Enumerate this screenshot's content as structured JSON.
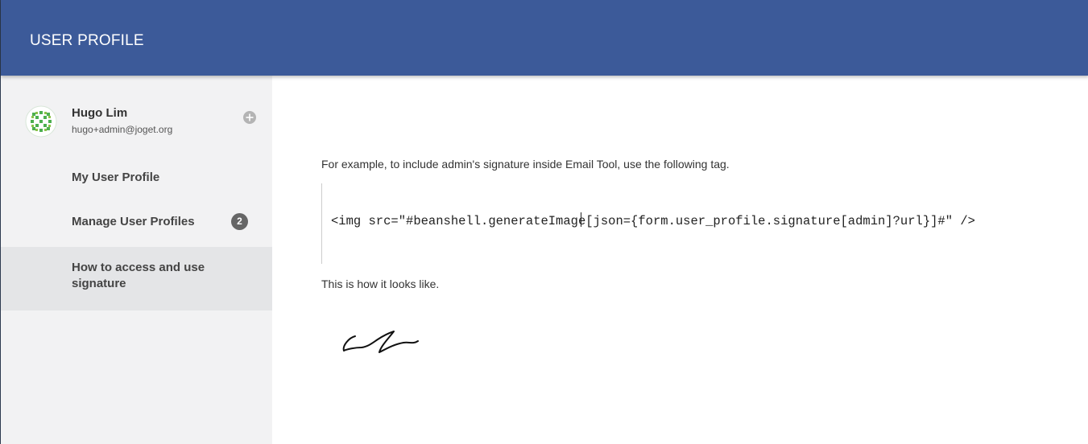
{
  "header": {
    "title": "USER PROFILE",
    "background": "#3c5a99"
  },
  "sidebar": {
    "user": {
      "name": "Hugo Lim",
      "email": "hugo+admin@joget.org",
      "avatar_icon": "identicon-avatar",
      "action_icon": "plus-circle-icon"
    },
    "items": [
      {
        "label": "My User Profile",
        "active": false
      },
      {
        "label": "Manage User Profiles",
        "badge": "2",
        "active": false
      },
      {
        "label": "How to access and use signature",
        "active": true
      }
    ]
  },
  "main": {
    "intro": "For example, to include admin's signature inside Email Tool, use the following tag.",
    "code": "<img src=\"#beanshell.generateImage[json={form.user_profile.signature[admin]?url}]#\" />",
    "outro": "This is how it looks like.",
    "signature_icon": "handwritten-signature"
  }
}
